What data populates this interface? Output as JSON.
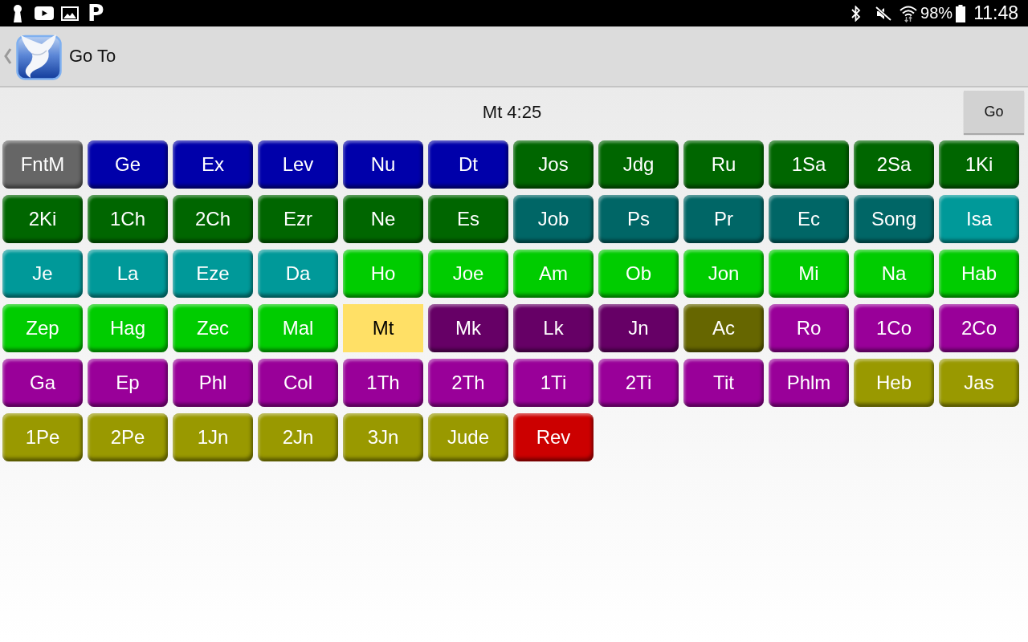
{
  "status_bar": {
    "notification_glyph": "P",
    "battery": "98%",
    "time": "11:48"
  },
  "app_bar": {
    "title": "Go To"
  },
  "reference": {
    "text": "Mt 4:25"
  },
  "go_button": {
    "label": "Go"
  },
  "books": [
    {
      "label": "FntM",
      "color": "#666666",
      "selected": false
    },
    {
      "label": "Ge",
      "color": "#0000aa",
      "selected": false
    },
    {
      "label": "Ex",
      "color": "#0000aa",
      "selected": false
    },
    {
      "label": "Lev",
      "color": "#0000aa",
      "selected": false
    },
    {
      "label": "Nu",
      "color": "#0000aa",
      "selected": false
    },
    {
      "label": "Dt",
      "color": "#0000aa",
      "selected": false
    },
    {
      "label": "Jos",
      "color": "#006600",
      "selected": false
    },
    {
      "label": "Jdg",
      "color": "#006600",
      "selected": false
    },
    {
      "label": "Ru",
      "color": "#006600",
      "selected": false
    },
    {
      "label": "1Sa",
      "color": "#006600",
      "selected": false
    },
    {
      "label": "2Sa",
      "color": "#006600",
      "selected": false
    },
    {
      "label": "1Ki",
      "color": "#006600",
      "selected": false
    },
    {
      "label": "2Ki",
      "color": "#006600",
      "selected": false
    },
    {
      "label": "1Ch",
      "color": "#006600",
      "selected": false
    },
    {
      "label": "2Ch",
      "color": "#006600",
      "selected": false
    },
    {
      "label": "Ezr",
      "color": "#006600",
      "selected": false
    },
    {
      "label": "Ne",
      "color": "#006600",
      "selected": false
    },
    {
      "label": "Es",
      "color": "#006600",
      "selected": false
    },
    {
      "label": "Job",
      "color": "#006666",
      "selected": false
    },
    {
      "label": "Ps",
      "color": "#006666",
      "selected": false
    },
    {
      "label": "Pr",
      "color": "#006666",
      "selected": false
    },
    {
      "label": "Ec",
      "color": "#006666",
      "selected": false
    },
    {
      "label": "Song",
      "color": "#006666",
      "selected": false
    },
    {
      "label": "Isa",
      "color": "#009999",
      "selected": false
    },
    {
      "label": "Je",
      "color": "#009999",
      "selected": false
    },
    {
      "label": "La",
      "color": "#009999",
      "selected": false
    },
    {
      "label": "Eze",
      "color": "#009999",
      "selected": false
    },
    {
      "label": "Da",
      "color": "#009999",
      "selected": false
    },
    {
      "label": "Ho",
      "color": "#00cc00",
      "selected": false
    },
    {
      "label": "Joe",
      "color": "#00cc00",
      "selected": false
    },
    {
      "label": "Am",
      "color": "#00cc00",
      "selected": false
    },
    {
      "label": "Ob",
      "color": "#00cc00",
      "selected": false
    },
    {
      "label": "Jon",
      "color": "#00cc00",
      "selected": false
    },
    {
      "label": "Mi",
      "color": "#00cc00",
      "selected": false
    },
    {
      "label": "Na",
      "color": "#00cc00",
      "selected": false
    },
    {
      "label": "Hab",
      "color": "#00cc00",
      "selected": false
    },
    {
      "label": "Zep",
      "color": "#00cc00",
      "selected": false
    },
    {
      "label": "Hag",
      "color": "#00cc00",
      "selected": false
    },
    {
      "label": "Zec",
      "color": "#00cc00",
      "selected": false
    },
    {
      "label": "Mal",
      "color": "#00cc00",
      "selected": false
    },
    {
      "label": "Mt",
      "color": "#ffe066",
      "selected": true
    },
    {
      "label": "Mk",
      "color": "#660066",
      "selected": false
    },
    {
      "label": "Lk",
      "color": "#660066",
      "selected": false
    },
    {
      "label": "Jn",
      "color": "#660066",
      "selected": false
    },
    {
      "label": "Ac",
      "color": "#666600",
      "selected": false
    },
    {
      "label": "Ro",
      "color": "#990099",
      "selected": false
    },
    {
      "label": "1Co",
      "color": "#990099",
      "selected": false
    },
    {
      "label": "2Co",
      "color": "#990099",
      "selected": false
    },
    {
      "label": "Ga",
      "color": "#990099",
      "selected": false
    },
    {
      "label": "Ep",
      "color": "#990099",
      "selected": false
    },
    {
      "label": "Phl",
      "color": "#990099",
      "selected": false
    },
    {
      "label": "Col",
      "color": "#990099",
      "selected": false
    },
    {
      "label": "1Th",
      "color": "#990099",
      "selected": false
    },
    {
      "label": "2Th",
      "color": "#990099",
      "selected": false
    },
    {
      "label": "1Ti",
      "color": "#990099",
      "selected": false
    },
    {
      "label": "2Ti",
      "color": "#990099",
      "selected": false
    },
    {
      "label": "Tit",
      "color": "#990099",
      "selected": false
    },
    {
      "label": "Phlm",
      "color": "#990099",
      "selected": false
    },
    {
      "label": "Heb",
      "color": "#999900",
      "selected": false
    },
    {
      "label": "Jas",
      "color": "#999900",
      "selected": false
    },
    {
      "label": "1Pe",
      "color": "#999900",
      "selected": false
    },
    {
      "label": "2Pe",
      "color": "#999900",
      "selected": false
    },
    {
      "label": "1Jn",
      "color": "#999900",
      "selected": false
    },
    {
      "label": "2Jn",
      "color": "#999900",
      "selected": false
    },
    {
      "label": "3Jn",
      "color": "#999900",
      "selected": false
    },
    {
      "label": "Jude",
      "color": "#999900",
      "selected": false
    },
    {
      "label": "Rev",
      "color": "#cc0000",
      "selected": false
    }
  ]
}
